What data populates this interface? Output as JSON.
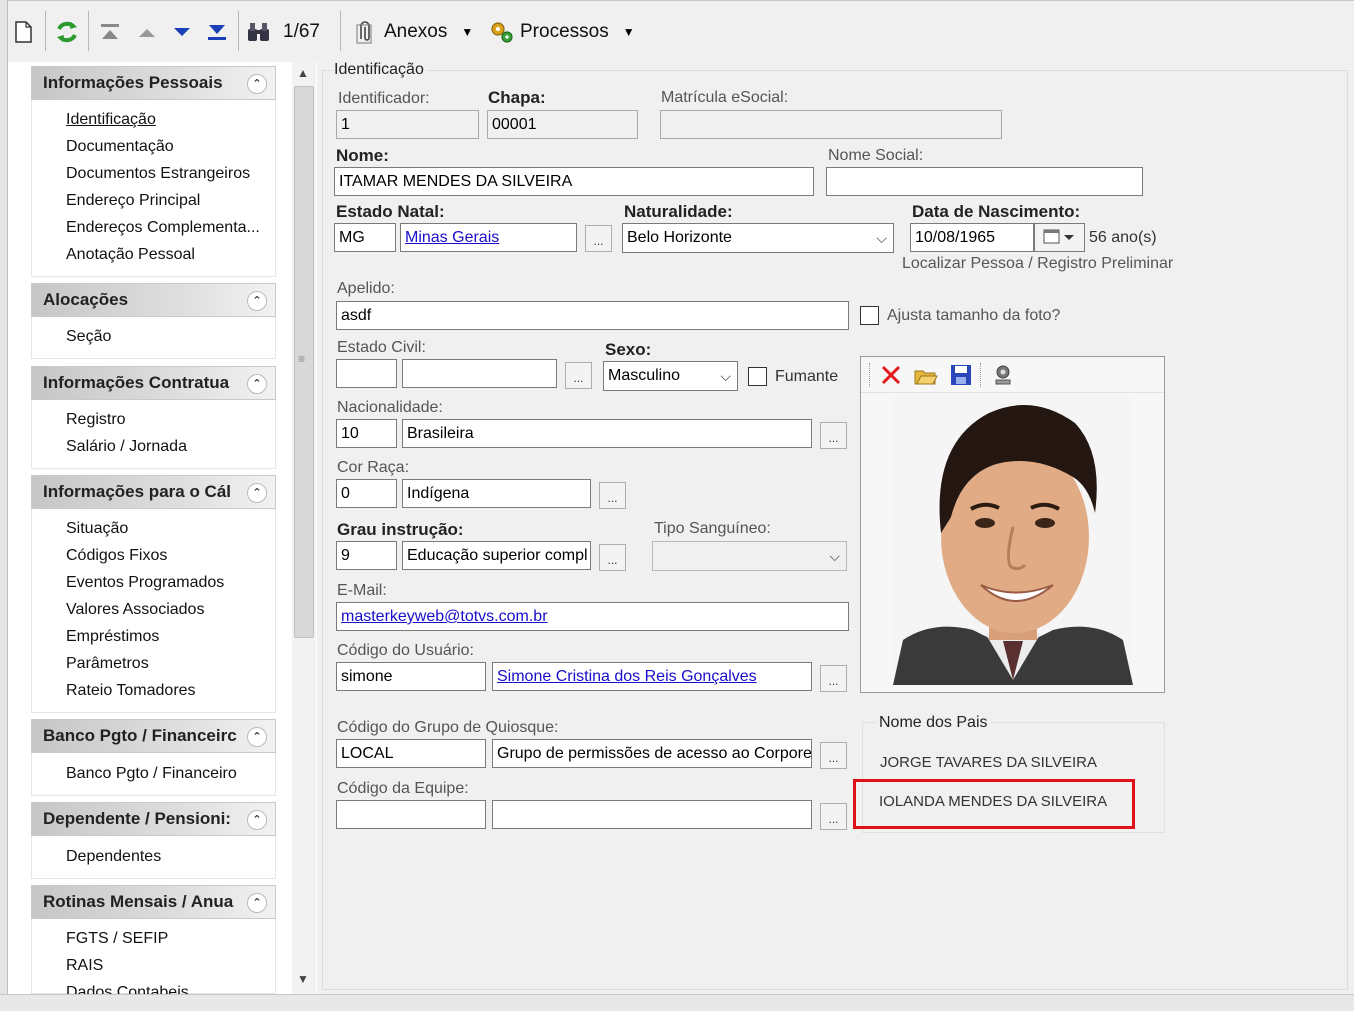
{
  "toolbar": {
    "record_counter": "1/67",
    "anexos_label": "Anexos",
    "processos_label": "Processos"
  },
  "sidebar": {
    "groups": [
      {
        "title": "Informações Pessoais",
        "items": [
          "Identificação",
          "Documentação",
          "Documentos Estrangeiros",
          "Endereço Principal",
          "Endereços Complementa...",
          "Anotação Pessoal"
        ]
      },
      {
        "title": "Alocações",
        "items": [
          "Seção"
        ]
      },
      {
        "title": "Informações Contratua",
        "items": [
          "Registro",
          "Salário / Jornada"
        ]
      },
      {
        "title": "Informações para o Cál",
        "items": [
          "Situação",
          "Códigos Fixos",
          "Eventos Programados",
          "Valores Associados",
          "Empréstimos",
          "Parâmetros",
          "Rateio Tomadores"
        ]
      },
      {
        "title": "Banco Pgto / Financeirc",
        "items": [
          "Banco Pgto / Financeiro"
        ]
      },
      {
        "title": "Dependente / Pensioni:",
        "items": [
          "Dependentes"
        ]
      },
      {
        "title": "Rotinas Mensais / Anua",
        "items": [
          "FGTS / SEFIP",
          "RAIS",
          "Dados Contabeis"
        ]
      }
    ]
  },
  "form": {
    "section_title": "Identificação",
    "identificador": {
      "label": "Identificador:",
      "value": "1"
    },
    "chapa": {
      "label": "Chapa:",
      "value": "00001"
    },
    "matricula": {
      "label": "Matrícula eSocial:",
      "value": ""
    },
    "nome": {
      "label": "Nome:",
      "value": "ITAMAR MENDES DA SILVEIRA"
    },
    "nome_social": {
      "label": "Nome Social:",
      "value": ""
    },
    "estado_natal": {
      "label": "Estado Natal:",
      "code": "MG",
      "name": "Minas Gerais"
    },
    "naturalidade": {
      "label": "Naturalidade:",
      "value": "Belo Horizonte"
    },
    "nascimento": {
      "label": "Data de Nascimento:",
      "value": "10/08/1965",
      "age": "56 ano(s)"
    },
    "localizar": "Localizar Pessoa / Registro Preliminar",
    "apelido": {
      "label": "Apelido:",
      "value": "asdf"
    },
    "ajusta_foto": "Ajusta tamanho da foto?",
    "estado_civil": {
      "label": "Estado Civil:",
      "code": "",
      "name": ""
    },
    "sexo": {
      "label": "Sexo:",
      "value": "Masculino"
    },
    "fumante": "Fumante",
    "nacionalidade": {
      "label": "Nacionalidade:",
      "code": "10",
      "name": "Brasileira"
    },
    "cor_raca": {
      "label": "Cor Raça:",
      "code": "0",
      "name": "Indígena"
    },
    "grau_instrucao": {
      "label": "Grau instrução:",
      "code": "9",
      "name": "Educação superior compl"
    },
    "tipo_sanguineo": {
      "label": "Tipo Sanguíneo:",
      "value": ""
    },
    "email": {
      "label": "E-Mail:",
      "value": "masterkeyweb@totvs.com.br"
    },
    "usuario": {
      "label": "Código do Usuário:",
      "code": "simone",
      "name": "Simone Cristina dos Reis Gonçalves"
    },
    "quiosque": {
      "label": "Código do Grupo de Quiosque:",
      "code": "LOCAL",
      "name": "Grupo de permissões de acesso ao Corporel"
    },
    "equipe": {
      "label": "Código da Equipe:",
      "code": "",
      "name": ""
    },
    "ellipsis": "..."
  },
  "parents": {
    "title": "Nome dos Pais",
    "father": "JORGE TAVARES DA SILVEIRA",
    "mother": "IOLANDA MENDES DA SILVEIRA"
  },
  "colors": {
    "highlight": "#e0101b",
    "link": "#1a0dcc"
  }
}
